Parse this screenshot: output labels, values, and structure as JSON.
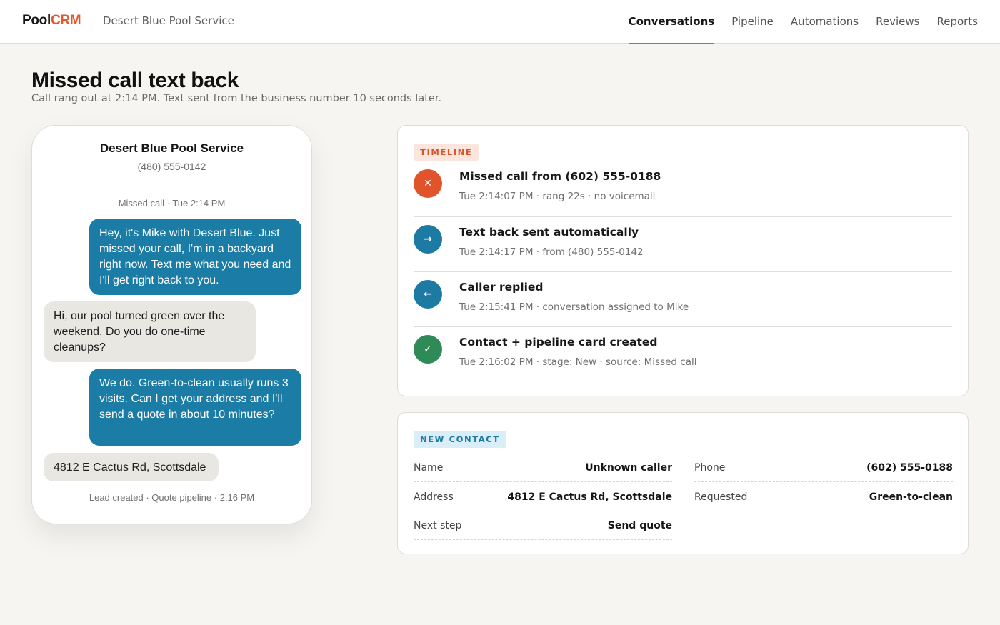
{
  "app": {
    "logo_part1": "Pool",
    "logo_part2": "CRM",
    "org_name": "Desert Blue Pool Service",
    "brand_color": "#e8542c"
  },
  "nav": {
    "tabs": [
      {
        "label": "Conversations",
        "active": true
      },
      {
        "label": "Pipeline",
        "active": false
      },
      {
        "label": "Automations",
        "active": false
      },
      {
        "label": "Reviews",
        "active": false
      },
      {
        "label": "Reports",
        "active": false
      }
    ]
  },
  "page": {
    "title": "Missed call text back",
    "subtitle": "Call rang out at 2:14 PM. Text sent from the business number 10 seconds later."
  },
  "phone": {
    "contact_name": "Desert Blue Pool Service",
    "contact_number": "(480) 555-0142",
    "top_meta": "Missed call · Tue 2:14 PM",
    "messages": [
      {
        "direction": "outgoing",
        "text": "Hey, it's Mike with Desert Blue. Just missed your call, I'm in a backyard right now. Text me what you need and I'll get right back to you."
      },
      {
        "direction": "incoming",
        "text": "Hi, our pool turned green over the weekend. Do you do one-time cleanups?"
      },
      {
        "direction": "outgoing",
        "text": "We do. Green-to-clean usually runs 3 visits. Can I get your address and I'll send a quote in about 10 minutes?"
      },
      {
        "direction": "incoming",
        "text": "4812 E Cactus Rd, Scottsdale"
      }
    ],
    "bottom_meta": "Lead created · Quote pipeline · 2:16 PM",
    "outgoing_color": "#1b7da6",
    "incoming_color": "#e9e7e2"
  },
  "timeline": {
    "tag": "TIMELINE",
    "items": [
      {
        "icon": "close-icon",
        "glyph": "✕",
        "color": "#e0532b",
        "title": "Missed call from (602) 555-0188",
        "detail": "Tue 2:14:07 PM · rang 22s · no voicemail"
      },
      {
        "icon": "arrow-right-icon",
        "glyph": "→",
        "color": "#1d7aa3",
        "title": "Text back sent automatically",
        "detail": "Tue 2:14:17 PM · from (480) 555-0142"
      },
      {
        "icon": "arrow-left-icon",
        "glyph": "←",
        "color": "#1d7aa3",
        "title": "Caller replied",
        "detail": "Tue 2:15:41 PM · conversation assigned to Mike"
      },
      {
        "icon": "check-icon",
        "glyph": "✓",
        "color": "#2e8b57",
        "title": "Contact + pipeline card created",
        "detail": "Tue 2:16:02 PM · stage: New · source: Missed call"
      }
    ]
  },
  "contact": {
    "tag": "NEW CONTACT",
    "fields": {
      "name": {
        "label": "Name",
        "value": "Unknown caller"
      },
      "phone": {
        "label": "Phone",
        "value": "(602) 555-0188"
      },
      "address": {
        "label": "Address",
        "value": "4812 E Cactus Rd, Scottsdale"
      },
      "requested": {
        "label": "Requested",
        "value": "Green-to-clean"
      },
      "next_step": {
        "label": "Next step",
        "value": "Send quote"
      }
    }
  }
}
